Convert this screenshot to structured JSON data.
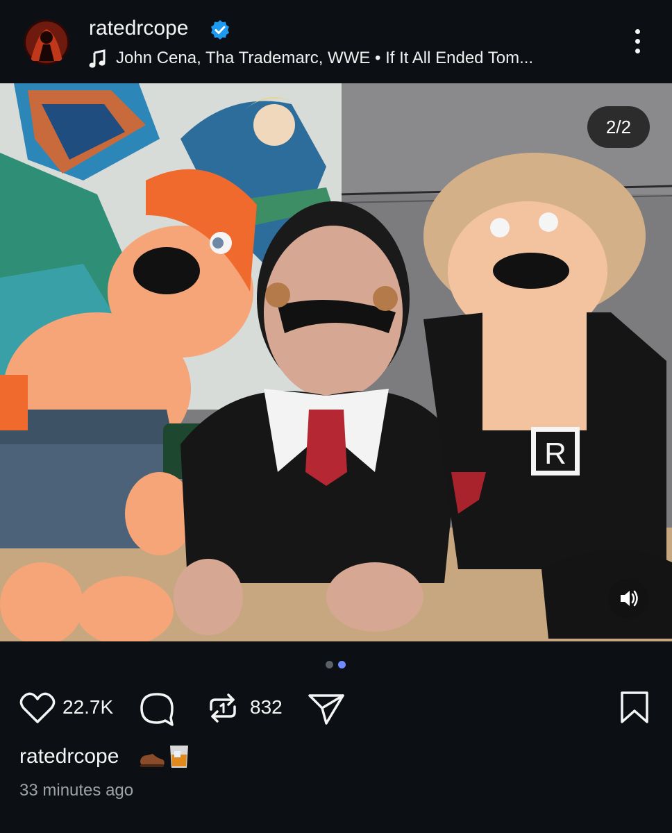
{
  "post": {
    "username": "ratedrcope",
    "verified": true,
    "audio_track": "John Cena, Tha Trademarc, WWE • If It All Ended Tom...",
    "media_counter": "2/2",
    "carousel": {
      "total": 2,
      "active": 2
    },
    "likes": "22.7K",
    "reposts": "832",
    "caption_user": "ratedrcope",
    "caption_emojis": [
      "shoe-icon",
      "whiskey-glass-icon"
    ],
    "timestamp": "33 minutes ago"
  },
  "icons": {
    "header": [
      "verified-badge-icon",
      "music-note-icon",
      "more-options-icon"
    ],
    "actions": [
      "heart-icon",
      "comment-icon",
      "repost-icon",
      "share-icon",
      "bookmark-icon"
    ],
    "media": [
      "sound-icon"
    ]
  },
  "colors": {
    "background": "#0c1014",
    "verified_blue": "#1d9bf0",
    "active_dot": "#6e8cff",
    "inactive_dot": "#5b6066",
    "muted_text": "#9ea3a8"
  }
}
